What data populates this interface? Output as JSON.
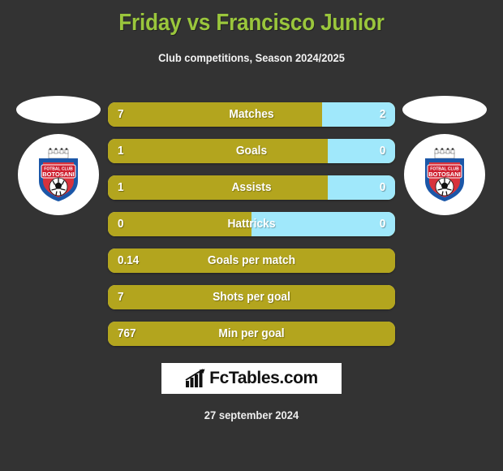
{
  "header": {
    "title": "Friday vs Francisco Junior",
    "subtitle": "Club competitions, Season 2024/2025",
    "title_color": "#9ac63c",
    "background_color": "#333333"
  },
  "teams": {
    "home": {
      "crest_name": "FOTBAL CLUB BOTOSANI",
      "crest_line1": "FOTBAL CLUB",
      "crest_line2": "BOTOSANI"
    },
    "away": {
      "crest_name": "FOTBAL CLUB BOTOSANI",
      "crest_line1": "FOTBAL CLUB",
      "crest_line2": "BOTOSANI"
    }
  },
  "colors": {
    "home_bar": "#b3a51e",
    "away_bar": "#a0e8fb"
  },
  "stats": [
    {
      "label": "Matches",
      "home": "7",
      "away": "2",
      "home_pct": 74.6,
      "split": true
    },
    {
      "label": "Goals",
      "home": "1",
      "away": "0",
      "home_pct": 76.6,
      "split": true
    },
    {
      "label": "Assists",
      "home": "1",
      "away": "0",
      "home_pct": 76.6,
      "split": true
    },
    {
      "label": "Hattricks",
      "home": "0",
      "away": "0",
      "home_pct": 50.0,
      "split": true
    },
    {
      "label": "Goals per match",
      "home": "0.14",
      "away": "",
      "home_pct": 100,
      "split": false
    },
    {
      "label": "Shots per goal",
      "home": "7",
      "away": "",
      "home_pct": 100,
      "split": false
    },
    {
      "label": "Min per goal",
      "home": "767",
      "away": "",
      "home_pct": 100,
      "split": false
    }
  ],
  "footer": {
    "logo_text": "FcTables.com",
    "logo_icon": "bar-chart-icon",
    "date": "27 september 2024"
  },
  "chart_data": {
    "type": "bar",
    "title": "Friday vs Francisco Junior",
    "subtitle": "Club competitions, Season 2024/2025",
    "orientation": "horizontal-split",
    "categories": [
      "Matches",
      "Goals",
      "Assists",
      "Hattricks",
      "Goals per match",
      "Shots per goal",
      "Min per goal"
    ],
    "series": [
      {
        "name": "Friday",
        "values": [
          7,
          1,
          1,
          0,
          0.14,
          7,
          767
        ]
      },
      {
        "name": "Francisco Junior",
        "values": [
          2,
          0,
          0,
          0,
          null,
          null,
          null
        ]
      }
    ],
    "xlabel": "",
    "ylabel": "",
    "grid": false,
    "legend": "none"
  }
}
